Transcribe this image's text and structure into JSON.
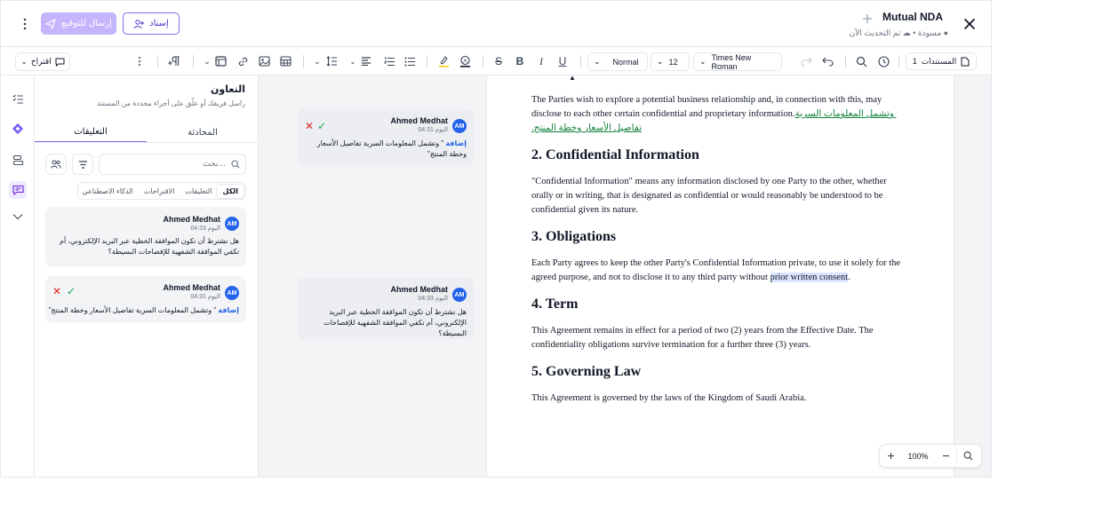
{
  "header": {
    "doc_title": "Mutual NDA",
    "status": "مسودة",
    "saved": "تم التحديث الآن",
    "send_label": "إرسال للتوقيع",
    "assign_label": "إسناد"
  },
  "toolbar": {
    "documents_label": "المستندات",
    "documents_count": "1",
    "font_family": "Times New Roman",
    "font_size": "12",
    "style": "Normal",
    "suggest_label": "اقتراح"
  },
  "collab": {
    "title": "التعاون",
    "subtitle": "راسل فريقك أو علّق على أجزاء محددة من المستند",
    "tabs": [
      "المحادثة",
      "التعليقات"
    ],
    "active_tab": "التعليقات",
    "search_placeholder": "بحث...",
    "filters": [
      "الكل",
      "التعليقات",
      "الاقتراحات",
      "الذكاء الاصطناعي"
    ],
    "cards": [
      {
        "initials": "AM",
        "author": "Ahmed Medhat",
        "time": "اليوم 04:33",
        "body": "هل نشترط أن تكون الموافقة الخطية عبر البريد الإلكتروني، أم تكفي الموافقة الشفهية للإفصاحات البسيطة؟"
      },
      {
        "initials": "AM",
        "author": "Ahmed Medhat",
        "time": "اليوم 04:31",
        "add_label": "إضافة",
        "body": "\" وتشمل المعلومات السرية تفاصيل الأسعار وخطة المنتج\""
      }
    ]
  },
  "margin": {
    "card1": {
      "initials": "AM",
      "author": "Ahmed Medhat",
      "time": "اليوم 04:31",
      "add_label": "إضافة",
      "body": "\" وتشمل المعلومات السرية تفاصيل الأسعار وخطة المنتج\""
    },
    "card2": {
      "initials": "AM",
      "author": "Ahmed Medhat",
      "time": "اليوم 04:33",
      "body": "هل نشترط أن تكون الموافقة الخطية عبر البريد الإلكتروني، أم تكفي الموافقة الشفهية للإفصاحات البسيطة؟"
    }
  },
  "doc": {
    "intro": "The Parties wish to explore a potential business relationship and, in connection with this, may disclose to each other certain confidential and proprietary information.",
    "intro_insert": " وتشمل المعلومات السرية تفاصيل الأسعار وخطة المنتج.",
    "h2": "2. Confidential Information",
    "p2": "\"Confidential Information\" means any information disclosed by one Party to the other, whether orally or in writing, that is designated as confidential or would reasonably be understood to be confidential given its nature.",
    "h3": "3. Obligations",
    "p3_before": "Each Party agrees to keep the other Party's Confidential Information private, to use it solely for the agreed purpose, and not to disclose it to any third party without ",
    "p3_highlight": "prior written consent",
    "p3_after": ".",
    "h4": "4. Term",
    "p4": "This Agreement remains in effect for a period of two (2) years from the Effective Date. The confidentiality obligations survive termination for a further three (3) years.",
    "h5": "5. Governing Law",
    "p5": "This Agreement is governed by the laws of the Kingdom of Saudi Arabia."
  },
  "zoom": {
    "value": "100%"
  }
}
